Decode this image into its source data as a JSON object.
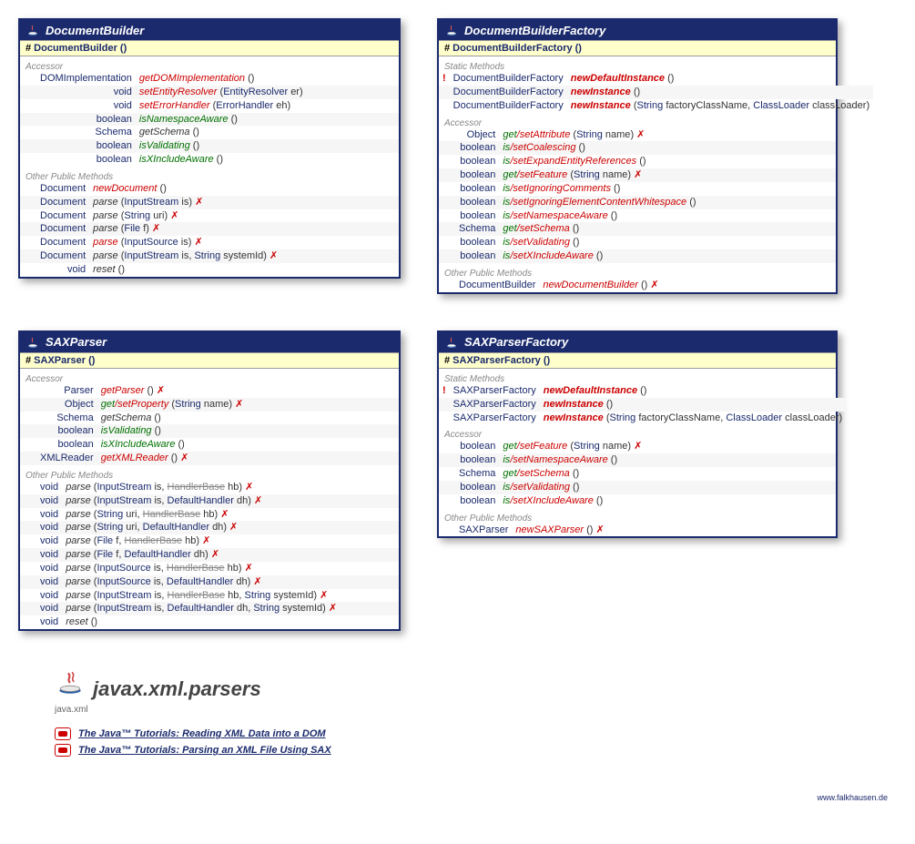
{
  "credit": "www.falkhausen.de",
  "packageTitle": "javax.xml.parsers",
  "packageSub": "java.xml",
  "tutorials": [
    "The Java™ Tutorials: Reading XML Data into a DOM",
    "The Java™ Tutorials: Parsing an XML File Using SAX"
  ],
  "cards": [
    {
      "title": "DocumentBuilder",
      "ctor": "DocumentBuilder",
      "sections": [
        {
          "label": "Accessor",
          "rows": [
            {
              "ret": "DOMImplementation",
              "name": "getDOMImplementation",
              "color": "red",
              "params": [],
              "throws": false
            },
            {
              "ret": "void",
              "name": "setEntityResolver",
              "color": "red",
              "params": [
                {
                  "t": "EntityResolver",
                  "n": "er"
                }
              ],
              "throws": false
            },
            {
              "ret": "void",
              "name": "setErrorHandler",
              "color": "red",
              "params": [
                {
                  "t": "ErrorHandler",
                  "n": "eh"
                }
              ],
              "throws": false
            },
            {
              "ret": "boolean",
              "name": "isNamespaceAware",
              "color": "green",
              "params": [],
              "throws": false
            },
            {
              "ret": "Schema",
              "name": "getSchema",
              "color": "dark",
              "params": [],
              "throws": false
            },
            {
              "ret": "boolean",
              "name": "isValidating",
              "color": "green",
              "params": [],
              "throws": false
            },
            {
              "ret": "boolean",
              "name": "isXIncludeAware",
              "color": "green",
              "params": [],
              "throws": false
            }
          ]
        },
        {
          "label": "Other Public Methods",
          "rows": [
            {
              "ret": "Document",
              "name": "newDocument",
              "color": "red",
              "params": [],
              "throws": false
            },
            {
              "ret": "Document",
              "name": "parse",
              "color": "dark",
              "params": [
                {
                  "t": "InputStream",
                  "n": "is"
                }
              ],
              "throws": true
            },
            {
              "ret": "Document",
              "name": "parse",
              "color": "dark",
              "params": [
                {
                  "t": "String",
                  "n": "uri"
                }
              ],
              "throws": true
            },
            {
              "ret": "Document",
              "name": "parse",
              "color": "dark",
              "params": [
                {
                  "t": "File",
                  "n": "f"
                }
              ],
              "throws": true
            },
            {
              "ret": "Document",
              "name": "parse",
              "color": "red",
              "italic": true,
              "params": [
                {
                  "t": "InputSource",
                  "n": "is"
                }
              ],
              "throws": true
            },
            {
              "ret": "Document",
              "name": "parse",
              "color": "dark",
              "params": [
                {
                  "t": "InputStream",
                  "n": "is"
                },
                {
                  "t": "String",
                  "n": "systemId"
                }
              ],
              "throws": true
            },
            {
              "ret": "void",
              "name": "reset",
              "color": "dark",
              "params": [],
              "throws": false
            }
          ]
        }
      ]
    },
    {
      "title": "DocumentBuilderFactory",
      "ctor": "DocumentBuilderFactory",
      "sections": [
        {
          "label": "Static Methods",
          "rows": [
            {
              "mark": "!",
              "ret": "DocumentBuilderFactory",
              "name": "newDefaultInstance",
              "color": "red",
              "bold": true,
              "params": [],
              "throws": false
            },
            {
              "ret": "DocumentBuilderFactory",
              "name": "newInstance",
              "color": "red",
              "bold": true,
              "params": [],
              "throws": false
            },
            {
              "ret": "DocumentBuilderFactory",
              "name": "newInstance",
              "color": "red",
              "bold": true,
              "params": [
                {
                  "t": "String",
                  "n": "factoryClassName"
                },
                {
                  "t": "ClassLoader",
                  "n": "classLoader"
                }
              ],
              "throws": false
            }
          ]
        },
        {
          "label": "Accessor",
          "rows": [
            {
              "ret": "Object",
              "name": "get/setAttribute",
              "split": [
                "get",
                "setAttribute"
              ],
              "params": [
                {
                  "t": "String",
                  "n": "name"
                }
              ],
              "throws": true
            },
            {
              "ret": "boolean",
              "name": "is/setCoalescing",
              "split": [
                "is",
                "setCoalescing"
              ],
              "params": [],
              "throws": false
            },
            {
              "ret": "boolean",
              "name": "is/setExpandEntityReferences",
              "split": [
                "is",
                "setExpandEntityReferences"
              ],
              "params": [],
              "throws": false
            },
            {
              "ret": "boolean",
              "name": "get/setFeature",
              "split": [
                "get",
                "setFeature"
              ],
              "params": [
                {
                  "t": "String",
                  "n": "name"
                }
              ],
              "throws": true
            },
            {
              "ret": "boolean",
              "name": "is/setIgnoringComments",
              "split": [
                "is",
                "setIgnoringComments"
              ],
              "params": [],
              "throws": false
            },
            {
              "ret": "boolean",
              "name": "is/setIgnoringElementContentWhitespace",
              "split": [
                "is",
                "setIgnoringElementContentWhitespace"
              ],
              "params": [],
              "throws": false
            },
            {
              "ret": "boolean",
              "name": "is/setNamespaceAware",
              "split": [
                "is",
                "setNamespaceAware"
              ],
              "params": [],
              "throws": false
            },
            {
              "ret": "Schema",
              "name": "get/setSchema",
              "split": [
                "get",
                "setSchema"
              ],
              "params": [],
              "throws": false
            },
            {
              "ret": "boolean",
              "name": "is/setValidating",
              "split": [
                "is",
                "setValidating"
              ],
              "params": [],
              "throws": false
            },
            {
              "ret": "boolean",
              "name": "is/setXIncludeAware",
              "split": [
                "is",
                "setXIncludeAware"
              ],
              "params": [],
              "throws": false
            }
          ]
        },
        {
          "label": "Other Public Methods",
          "rows": [
            {
              "ret": "DocumentBuilder",
              "name": "newDocumentBuilder",
              "color": "red",
              "params": [],
              "throws": true
            }
          ]
        }
      ]
    },
    {
      "title": "SAXParser",
      "ctor": "SAXParser",
      "sections": [
        {
          "label": "Accessor",
          "rows": [
            {
              "ret": "Parser",
              "name": "getParser",
              "color": "red",
              "params": [],
              "throws": true
            },
            {
              "ret": "Object",
              "name": "get/setProperty",
              "split": [
                "get",
                "setProperty"
              ],
              "params": [
                {
                  "t": "String",
                  "n": "name"
                }
              ],
              "throws": true
            },
            {
              "ret": "Schema",
              "name": "getSchema",
              "color": "dark",
              "params": [],
              "throws": false
            },
            {
              "ret": "boolean",
              "name": "isValidating",
              "color": "green",
              "params": [],
              "throws": false
            },
            {
              "ret": "boolean",
              "name": "isXIncludeAware",
              "color": "green",
              "params": [],
              "throws": false
            },
            {
              "ret": "XMLReader",
              "name": "getXMLReader",
              "color": "red",
              "params": [],
              "throws": true
            }
          ]
        },
        {
          "label": "Other Public Methods",
          "rows": [
            {
              "ret": "void",
              "name": "parse",
              "color": "dark",
              "params": [
                {
                  "t": "InputStream",
                  "n": "is"
                },
                {
                  "t": "HandlerBase",
                  "n": "hb",
                  "strike": true
                }
              ],
              "throws": true
            },
            {
              "ret": "void",
              "name": "parse",
              "color": "dark",
              "params": [
                {
                  "t": "InputStream",
                  "n": "is"
                },
                {
                  "t": "DefaultHandler",
                  "n": "dh"
                }
              ],
              "throws": true
            },
            {
              "ret": "void",
              "name": "parse",
              "color": "dark",
              "params": [
                {
                  "t": "String",
                  "n": "uri"
                },
                {
                  "t": "HandlerBase",
                  "n": "hb",
                  "strike": true
                }
              ],
              "throws": true
            },
            {
              "ret": "void",
              "name": "parse",
              "color": "dark",
              "params": [
                {
                  "t": "String",
                  "n": "uri"
                },
                {
                  "t": "DefaultHandler",
                  "n": "dh"
                }
              ],
              "throws": true
            },
            {
              "ret": "void",
              "name": "parse",
              "color": "dark",
              "params": [
                {
                  "t": "File",
                  "n": "f"
                },
                {
                  "t": "HandlerBase",
                  "n": "hb",
                  "strike": true
                }
              ],
              "throws": true
            },
            {
              "ret": "void",
              "name": "parse",
              "color": "dark",
              "params": [
                {
                  "t": "File",
                  "n": "f"
                },
                {
                  "t": "DefaultHandler",
                  "n": "dh"
                }
              ],
              "throws": true
            },
            {
              "ret": "void",
              "name": "parse",
              "color": "dark",
              "params": [
                {
                  "t": "InputSource",
                  "n": "is"
                },
                {
                  "t": "HandlerBase",
                  "n": "hb",
                  "strike": true
                }
              ],
              "throws": true
            },
            {
              "ret": "void",
              "name": "parse",
              "color": "dark",
              "params": [
                {
                  "t": "InputSource",
                  "n": "is"
                },
                {
                  "t": "DefaultHandler",
                  "n": "dh"
                }
              ],
              "throws": true
            },
            {
              "ret": "void",
              "name": "parse",
              "color": "dark",
              "params": [
                {
                  "t": "InputStream",
                  "n": "is"
                },
                {
                  "t": "HandlerBase",
                  "n": "hb",
                  "strike": true
                },
                {
                  "t": "String",
                  "n": "systemId"
                }
              ],
              "throws": true
            },
            {
              "ret": "void",
              "name": "parse",
              "color": "dark",
              "params": [
                {
                  "t": "InputStream",
                  "n": "is"
                },
                {
                  "t": "DefaultHandler",
                  "n": "dh"
                },
                {
                  "t": "String",
                  "n": "systemId"
                }
              ],
              "throws": true
            },
            {
              "ret": "void",
              "name": "reset",
              "color": "dark",
              "params": [],
              "throws": false
            }
          ]
        }
      ]
    },
    {
      "title": "SAXParserFactory",
      "ctor": "SAXParserFactory",
      "sections": [
        {
          "label": "Static Methods",
          "rows": [
            {
              "mark": "!",
              "ret": "SAXParserFactory",
              "name": "newDefaultInstance",
              "color": "red",
              "bold": true,
              "params": [],
              "throws": false
            },
            {
              "ret": "SAXParserFactory",
              "name": "newInstance",
              "color": "red",
              "bold": true,
              "params": [],
              "throws": false
            },
            {
              "ret": "SAXParserFactory",
              "name": "newInstance",
              "color": "red",
              "bold": true,
              "params": [
                {
                  "t": "String",
                  "n": "factoryClassName"
                },
                {
                  "t": "ClassLoader",
                  "n": "classLoader"
                }
              ],
              "throws": false
            }
          ]
        },
        {
          "label": "Accessor",
          "rows": [
            {
              "ret": "boolean",
              "name": "get/setFeature",
              "split": [
                "get",
                "setFeature"
              ],
              "params": [
                {
                  "t": "String",
                  "n": "name"
                }
              ],
              "throws": true
            },
            {
              "ret": "boolean",
              "name": "is/setNamespaceAware",
              "split": [
                "is",
                "setNamespaceAware"
              ],
              "params": [],
              "throws": false
            },
            {
              "ret": "Schema",
              "name": "get/setSchema",
              "split": [
                "get",
                "setSchema"
              ],
              "params": [],
              "throws": false
            },
            {
              "ret": "boolean",
              "name": "is/setValidating",
              "split": [
                "is",
                "setValidating"
              ],
              "params": [],
              "throws": false
            },
            {
              "ret": "boolean",
              "name": "is/setXIncludeAware",
              "split": [
                "is",
                "setXIncludeAware"
              ],
              "params": [],
              "throws": false
            }
          ]
        },
        {
          "label": "Other Public Methods",
          "rows": [
            {
              "ret": "SAXParser",
              "name": "newSAXParser",
              "color": "red",
              "params": [],
              "throws": true
            }
          ]
        }
      ]
    }
  ]
}
